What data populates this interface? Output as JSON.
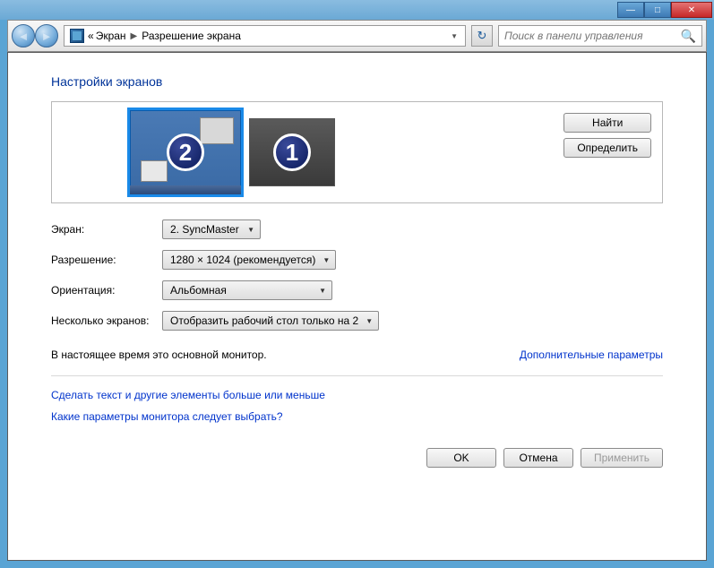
{
  "titlebar": {
    "min": "—",
    "max": "□",
    "close": "✕"
  },
  "nav": {
    "back": "◄",
    "forward": "►",
    "bc_back": "«",
    "bc_item1": "Экран",
    "bc_item2": "Разрешение экрана",
    "bc_sep": "▶",
    "refresh": "↻",
    "search_ph": "Поиск в панели управления",
    "search_icon": "🔍"
  },
  "page": {
    "title": "Настройки экранов"
  },
  "monitors": {
    "num1": "1",
    "num2": "2"
  },
  "side": {
    "find": "Найти",
    "detect": "Определить"
  },
  "form": {
    "display_label": "Экран:",
    "display_val": "2. SyncMaster",
    "res_label": "Разрешение:",
    "res_val": "1280 × 1024 (рекомендуется)",
    "orient_label": "Ориентация:",
    "orient_val": "Альбомная",
    "multi_label": "Несколько экранов:",
    "multi_val": "Отобразить рабочий стол только на 2"
  },
  "status": {
    "text": "В настоящее время это основной монитор.",
    "adv": "Дополнительные параметры"
  },
  "links": {
    "textsize": "Сделать текст и другие элементы больше или меньше",
    "which": "Какие параметры монитора следует выбрать?"
  },
  "actions": {
    "ok": "OK",
    "cancel": "Отмена",
    "apply": "Применить"
  },
  "dd_arrow": "▼"
}
